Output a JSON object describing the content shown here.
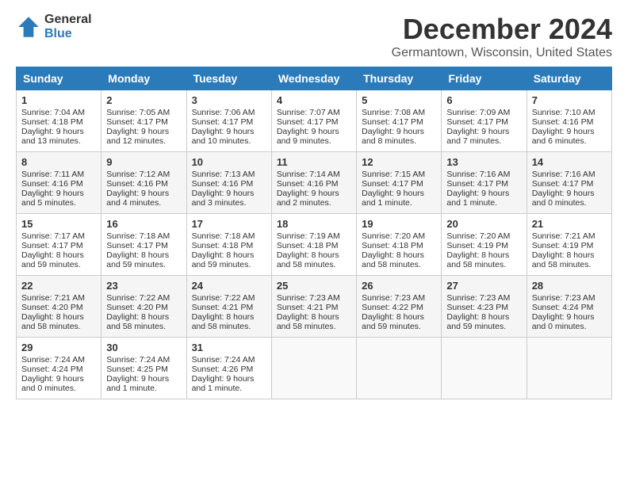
{
  "header": {
    "logo_general": "General",
    "logo_blue": "Blue",
    "month_title": "December 2024",
    "location": "Germantown, Wisconsin, United States"
  },
  "days_of_week": [
    "Sunday",
    "Monday",
    "Tuesday",
    "Wednesday",
    "Thursday",
    "Friday",
    "Saturday"
  ],
  "weeks": [
    [
      {
        "day": "1",
        "sunrise": "Sunrise: 7:04 AM",
        "sunset": "Sunset: 4:18 PM",
        "daylight": "Daylight: 9 hours and 13 minutes."
      },
      {
        "day": "2",
        "sunrise": "Sunrise: 7:05 AM",
        "sunset": "Sunset: 4:17 PM",
        "daylight": "Daylight: 9 hours and 12 minutes."
      },
      {
        "day": "3",
        "sunrise": "Sunrise: 7:06 AM",
        "sunset": "Sunset: 4:17 PM",
        "daylight": "Daylight: 9 hours and 10 minutes."
      },
      {
        "day": "4",
        "sunrise": "Sunrise: 7:07 AM",
        "sunset": "Sunset: 4:17 PM",
        "daylight": "Daylight: 9 hours and 9 minutes."
      },
      {
        "day": "5",
        "sunrise": "Sunrise: 7:08 AM",
        "sunset": "Sunset: 4:17 PM",
        "daylight": "Daylight: 9 hours and 8 minutes."
      },
      {
        "day": "6",
        "sunrise": "Sunrise: 7:09 AM",
        "sunset": "Sunset: 4:17 PM",
        "daylight": "Daylight: 9 hours and 7 minutes."
      },
      {
        "day": "7",
        "sunrise": "Sunrise: 7:10 AM",
        "sunset": "Sunset: 4:16 PM",
        "daylight": "Daylight: 9 hours and 6 minutes."
      }
    ],
    [
      {
        "day": "8",
        "sunrise": "Sunrise: 7:11 AM",
        "sunset": "Sunset: 4:16 PM",
        "daylight": "Daylight: 9 hours and 5 minutes."
      },
      {
        "day": "9",
        "sunrise": "Sunrise: 7:12 AM",
        "sunset": "Sunset: 4:16 PM",
        "daylight": "Daylight: 9 hours and 4 minutes."
      },
      {
        "day": "10",
        "sunrise": "Sunrise: 7:13 AM",
        "sunset": "Sunset: 4:16 PM",
        "daylight": "Daylight: 9 hours and 3 minutes."
      },
      {
        "day": "11",
        "sunrise": "Sunrise: 7:14 AM",
        "sunset": "Sunset: 4:16 PM",
        "daylight": "Daylight: 9 hours and 2 minutes."
      },
      {
        "day": "12",
        "sunrise": "Sunrise: 7:15 AM",
        "sunset": "Sunset: 4:17 PM",
        "daylight": "Daylight: 9 hours and 1 minute."
      },
      {
        "day": "13",
        "sunrise": "Sunrise: 7:16 AM",
        "sunset": "Sunset: 4:17 PM",
        "daylight": "Daylight: 9 hours and 1 minute."
      },
      {
        "day": "14",
        "sunrise": "Sunrise: 7:16 AM",
        "sunset": "Sunset: 4:17 PM",
        "daylight": "Daylight: 9 hours and 0 minutes."
      }
    ],
    [
      {
        "day": "15",
        "sunrise": "Sunrise: 7:17 AM",
        "sunset": "Sunset: 4:17 PM",
        "daylight": "Daylight: 8 hours and 59 minutes."
      },
      {
        "day": "16",
        "sunrise": "Sunrise: 7:18 AM",
        "sunset": "Sunset: 4:17 PM",
        "daylight": "Daylight: 8 hours and 59 minutes."
      },
      {
        "day": "17",
        "sunrise": "Sunrise: 7:18 AM",
        "sunset": "Sunset: 4:18 PM",
        "daylight": "Daylight: 8 hours and 59 minutes."
      },
      {
        "day": "18",
        "sunrise": "Sunrise: 7:19 AM",
        "sunset": "Sunset: 4:18 PM",
        "daylight": "Daylight: 8 hours and 58 minutes."
      },
      {
        "day": "19",
        "sunrise": "Sunrise: 7:20 AM",
        "sunset": "Sunset: 4:18 PM",
        "daylight": "Daylight: 8 hours and 58 minutes."
      },
      {
        "day": "20",
        "sunrise": "Sunrise: 7:20 AM",
        "sunset": "Sunset: 4:19 PM",
        "daylight": "Daylight: 8 hours and 58 minutes."
      },
      {
        "day": "21",
        "sunrise": "Sunrise: 7:21 AM",
        "sunset": "Sunset: 4:19 PM",
        "daylight": "Daylight: 8 hours and 58 minutes."
      }
    ],
    [
      {
        "day": "22",
        "sunrise": "Sunrise: 7:21 AM",
        "sunset": "Sunset: 4:20 PM",
        "daylight": "Daylight: 8 hours and 58 minutes."
      },
      {
        "day": "23",
        "sunrise": "Sunrise: 7:22 AM",
        "sunset": "Sunset: 4:20 PM",
        "daylight": "Daylight: 8 hours and 58 minutes."
      },
      {
        "day": "24",
        "sunrise": "Sunrise: 7:22 AM",
        "sunset": "Sunset: 4:21 PM",
        "daylight": "Daylight: 8 hours and 58 minutes."
      },
      {
        "day": "25",
        "sunrise": "Sunrise: 7:23 AM",
        "sunset": "Sunset: 4:21 PM",
        "daylight": "Daylight: 8 hours and 58 minutes."
      },
      {
        "day": "26",
        "sunrise": "Sunrise: 7:23 AM",
        "sunset": "Sunset: 4:22 PM",
        "daylight": "Daylight: 8 hours and 59 minutes."
      },
      {
        "day": "27",
        "sunrise": "Sunrise: 7:23 AM",
        "sunset": "Sunset: 4:23 PM",
        "daylight": "Daylight: 8 hours and 59 minutes."
      },
      {
        "day": "28",
        "sunrise": "Sunrise: 7:23 AM",
        "sunset": "Sunset: 4:24 PM",
        "daylight": "Daylight: 9 hours and 0 minutes."
      }
    ],
    [
      {
        "day": "29",
        "sunrise": "Sunrise: 7:24 AM",
        "sunset": "Sunset: 4:24 PM",
        "daylight": "Daylight: 9 hours and 0 minutes."
      },
      {
        "day": "30",
        "sunrise": "Sunrise: 7:24 AM",
        "sunset": "Sunset: 4:25 PM",
        "daylight": "Daylight: 9 hours and 1 minute."
      },
      {
        "day": "31",
        "sunrise": "Sunrise: 7:24 AM",
        "sunset": "Sunset: 4:26 PM",
        "daylight": "Daylight: 9 hours and 1 minute."
      },
      {
        "day": "",
        "sunrise": "",
        "sunset": "",
        "daylight": ""
      },
      {
        "day": "",
        "sunrise": "",
        "sunset": "",
        "daylight": ""
      },
      {
        "day": "",
        "sunrise": "",
        "sunset": "",
        "daylight": ""
      },
      {
        "day": "",
        "sunrise": "",
        "sunset": "",
        "daylight": ""
      }
    ]
  ]
}
